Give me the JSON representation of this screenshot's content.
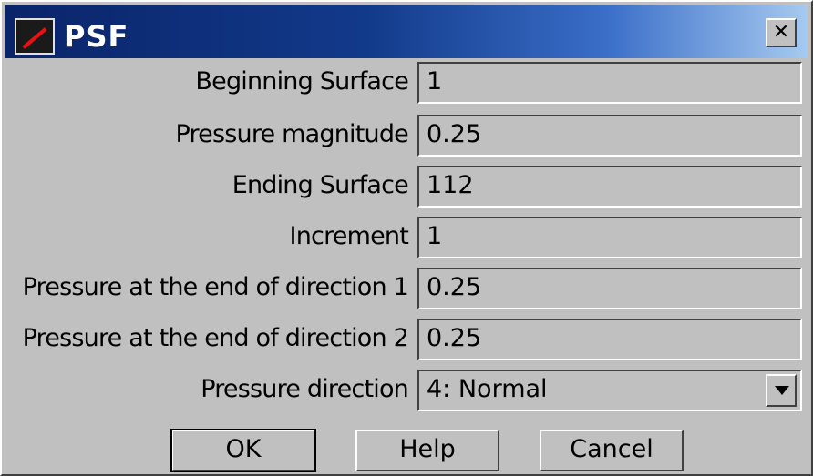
{
  "window": {
    "title": "PSF",
    "close_glyph": "✕"
  },
  "fields": [
    {
      "label": "Beginning Surface",
      "value": "1"
    },
    {
      "label": "Pressure magnitude",
      "value": "0.25"
    },
    {
      "label": "Ending Surface",
      "value": "112"
    },
    {
      "label": "Increment",
      "value": "1"
    },
    {
      "label": "Pressure at the end of direction 1",
      "value": "0.25"
    },
    {
      "label": "Pressure at the end of direction 2",
      "value": "0.25"
    }
  ],
  "direction": {
    "label": "Pressure direction",
    "selected": "4: Normal"
  },
  "buttons": {
    "ok": "OK",
    "help": "Help",
    "cancel": "Cancel"
  },
  "colors": {
    "titlebar_start": "#0a246a",
    "titlebar_end": "#a6caf0",
    "face": "#c0c0c0"
  }
}
